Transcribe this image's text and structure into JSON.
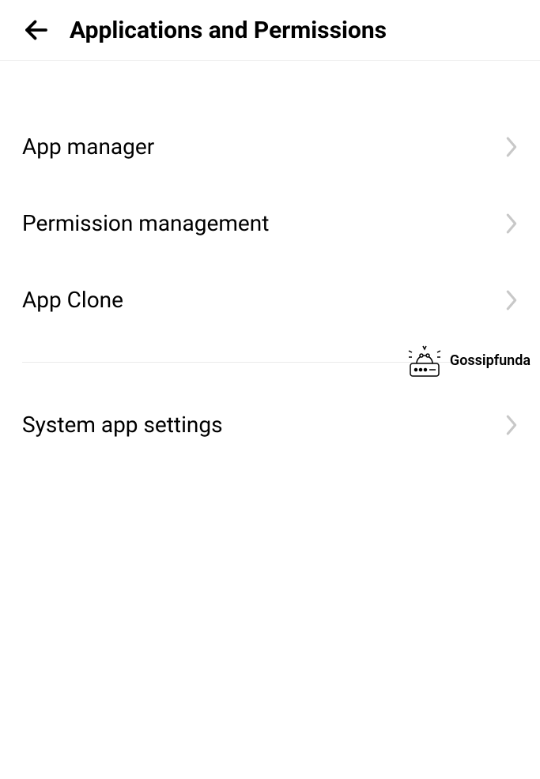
{
  "header": {
    "title": "Applications and Permissions"
  },
  "items": {
    "group1": [
      {
        "label": "App manager"
      },
      {
        "label": "Permission management"
      },
      {
        "label": "App Clone"
      }
    ],
    "group2": [
      {
        "label": "System app settings"
      }
    ]
  },
  "watermark": {
    "text": "Gossipfunda"
  }
}
